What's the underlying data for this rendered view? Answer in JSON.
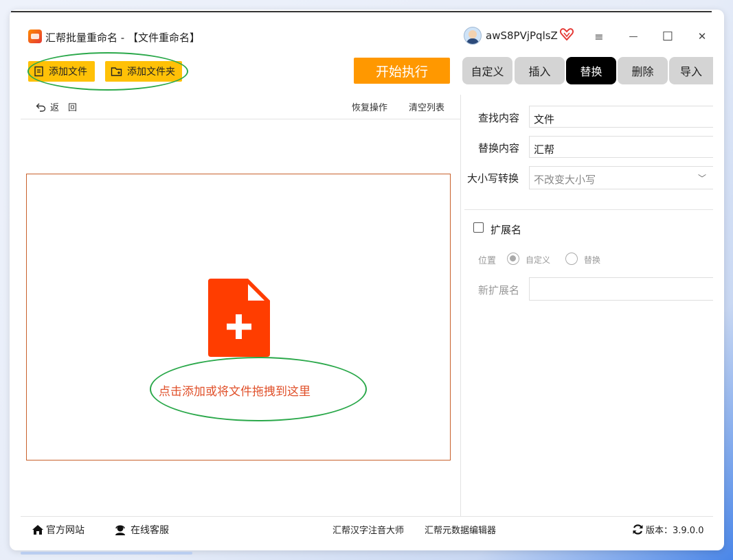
{
  "window": {
    "title": "汇帮批量重命名 - 【文件重命名】",
    "username": "awS8PVjPqlsZ",
    "controls": {
      "menu": "≡",
      "minimize": "—",
      "maximize": "☐",
      "close": "✕"
    }
  },
  "toolbar": {
    "add_file": "添加文件",
    "add_folder": "添加文件夹",
    "start": "开始执行",
    "back": "返　回",
    "restore": "恢复操作",
    "clear": "清空列表"
  },
  "dropzone": {
    "text": "点击添加或将文件拖拽到这里"
  },
  "tabs": [
    {
      "label": "自定义",
      "active": false
    },
    {
      "label": "插入",
      "active": false
    },
    {
      "label": "替换",
      "active": true
    },
    {
      "label": "删除",
      "active": false
    },
    {
      "label": "导入",
      "active": false
    }
  ],
  "form": {
    "find_label": "查找内容",
    "find_value": "文件",
    "replace_label": "替换内容",
    "replace_value": "汇帮",
    "case_label": "大小写转换",
    "case_value": "不改变大小写",
    "ext_label": "扩展名",
    "ext_checked": false,
    "position_label": "位置",
    "radio_custom": "自定义",
    "radio_replace": "替换",
    "radio_selected": "自定义",
    "new_ext_label": "新扩展名",
    "new_ext_value": ""
  },
  "footer": {
    "website": "官方网站",
    "support": "在线客服",
    "link1": "汇帮汉字注音大师",
    "link2": "汇帮元数据编辑器",
    "version": "版本：3.9.0.0"
  },
  "colors": {
    "accent_yellow": "#ffc107",
    "accent_orange": "#ff9800",
    "drop_text": "#e0502a",
    "file_icon": "#ff3d00",
    "highlight_ellipse": "#2aa84a",
    "active_tab": "#000000"
  }
}
